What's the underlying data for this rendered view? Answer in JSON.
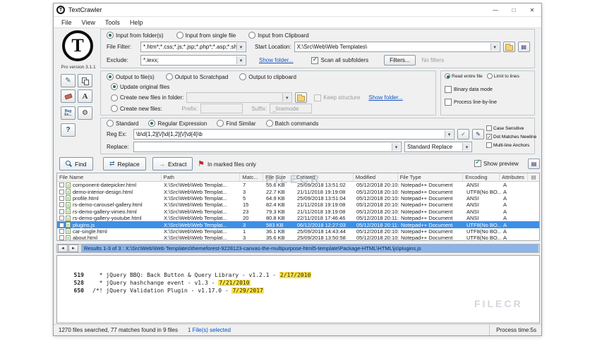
{
  "watermark": "FILECR",
  "window": {
    "title": "TextCrawler",
    "minimize": "—",
    "maximize": "□",
    "close": "✕"
  },
  "menu": {
    "items": [
      "File",
      "View",
      "Tools",
      "Help"
    ]
  },
  "icons": {
    "prev": "◄",
    "next": "►",
    "swap": "⇄",
    "extract": "→",
    "flag": "⚑",
    "gear": "⚙",
    "pencil": "✎",
    "grid": "▤",
    "check": "✓"
  },
  "sidebar": {
    "logo_letter": "T",
    "version": "Pro version 3.1.1",
    "regex_button": "Reg Ex...",
    "letter_button": "A",
    "help_button": "?"
  },
  "input_panel": {
    "radio_folder": "Input from folder(s)",
    "radio_single": "Input from single file",
    "radio_clipboard": "Input from Clipboard",
    "file_filter_label": "File Filter:",
    "file_filter_value": "*.htm*;*.css;*.js;*.jsp;*.php*;*.asp;*.shtml",
    "start_location_label": "Start Location:",
    "start_location_value": "X:\\Src\\Web\\Web Templates\\",
    "exclude_label": "Exclude:",
    "exclude_value": "*.iexx;",
    "show_folder_link": "Show folder...",
    "scan_subfolders": "Scan all subfolders",
    "filters_button": "Filters...",
    "no_filters": "No filters"
  },
  "output_panel": {
    "radio_files": "Output to file(s)",
    "radio_scratchpad": "Output to Scratchpad",
    "radio_clipboard": "Output to clipboard",
    "radio_update": "Update original files",
    "radio_new_folder": "Create new files in folder:",
    "keep_structure": "Keep structure",
    "show_folder_link": "Show folder...",
    "radio_new_files": "Create new files:",
    "prefix_label": "Prefix:",
    "prefix_value": "",
    "suffix_label": "Suffix:",
    "suffix_value": "_linemode"
  },
  "read_panel": {
    "radio_entire": "Read entire file",
    "radio_limit": "Limit to lines",
    "binary_mode": "Binary data mode",
    "line_by_line": "Process line-by-line"
  },
  "search_panel": {
    "radio_standard": "Standard",
    "radio_regex": "Regular Expression",
    "radio_similar": "Find Similar",
    "radio_batch": "Batch commands",
    "regex_label": "Reg Ex:",
    "regex_value": "\\b\\d{1,2}[\\/]\\d{1,2}[\\/]\\d{4}\\b",
    "replace_label": "Replace:",
    "replace_value": "",
    "replace_mode": "Standard Replace",
    "case_sensitive": "Case Sensitive",
    "dot_matches": "Dot Matches Newline",
    "multiline": "Multi-line Anchors"
  },
  "actions": {
    "find": "Find",
    "replace": "Replace",
    "extract": "Extract",
    "marked_only": "In marked files only",
    "show_preview": "Show preview"
  },
  "table": {
    "headers": [
      "File Name",
      "Path",
      "Matc...",
      "File Size",
      "Created",
      "Modified",
      "File Type",
      "Encoding",
      "Attributes"
    ],
    "rows": [
      {
        "name": "component-datepicker.html",
        "path": "X:\\Src\\Web\\Web Templat...",
        "matches": "7",
        "size": "55.6 KB",
        "created": "25/09/2018 13:51:02",
        "modified": "05/12/2018 20:10:...",
        "type": "Notepad++ Document",
        "encoding": "ANSI",
        "attrs": "A",
        "selected": false
      },
      {
        "name": "demo-interior-design.html",
        "path": "X:\\Src\\Web\\Web Templat...",
        "matches": "3",
        "size": "22.7 KB",
        "created": "21/11/2018 19:19:08",
        "modified": "05/12/2018 20:10:...",
        "type": "Notepad++ Document",
        "encoding": "UTF8(No BO...",
        "attrs": "A",
        "selected": false
      },
      {
        "name": "profile.html",
        "path": "X:\\Src\\Web\\Web Templat...",
        "matches": "5",
        "size": "64.9 KB",
        "created": "25/09/2018 13:51:04",
        "modified": "05/12/2018 20:10:...",
        "type": "Notepad++ Document",
        "encoding": "ANSI",
        "attrs": "A",
        "selected": false
      },
      {
        "name": "rs-demo-carousel-gallery.html",
        "path": "X:\\Src\\Web\\Web Templat...",
        "matches": "15",
        "size": "82.4 KB",
        "created": "21/11/2018 19:19:08",
        "modified": "05/12/2018 20:10:...",
        "type": "Notepad++ Document",
        "encoding": "ANSI",
        "attrs": "A",
        "selected": false
      },
      {
        "name": "rs-demo-gallery-vimeo.html",
        "path": "X:\\Src\\Web\\Web Templat...",
        "matches": "23",
        "size": "79.3 KB",
        "created": "21/11/2018 19:19:08",
        "modified": "05/12/2018 20:10:...",
        "type": "Notepad++ Document",
        "encoding": "ANSI",
        "attrs": "A",
        "selected": false
      },
      {
        "name": "rs-demo-gallery-youtube.html",
        "path": "X:\\Src\\Web\\Web Templat...",
        "matches": "20",
        "size": "80.8 KB",
        "created": "22/11/2018 17:46:46",
        "modified": "05/12/2018 20:11:...",
        "type": "Notepad++ Document",
        "encoding": "ANSI",
        "attrs": "A",
        "selected": false
      },
      {
        "name": "plugins.js",
        "path": "X:\\Src\\Web\\Web Templat...",
        "matches": "3",
        "size": "583 KB",
        "created": "06/12/2018 12:27:03",
        "modified": "05/12/2018 20:11:...",
        "type": "Notepad++ Document",
        "encoding": "UTF8(No BO...",
        "attrs": "A",
        "selected": true
      },
      {
        "name": "car-single.html",
        "path": "X:\\Src\\Web\\Web Templat...",
        "matches": "1",
        "size": "36.1 KB",
        "created": "25/09/2018 14:43:44",
        "modified": "05/12/2018 20:10:...",
        "type": "Notepad++ Document",
        "encoding": "UTF8(No BO...",
        "attrs": "A",
        "selected": false
      },
      {
        "name": "about.html",
        "path": "X:\\Src\\Web\\Web Templat...",
        "matches": "3",
        "size": "35.6 KB",
        "created": "25/09/2018 13:50:58",
        "modified": "05/12/2018 20:10:...",
        "type": "Notepad++ Document",
        "encoding": "UTF8(No BO...",
        "attrs": "A",
        "selected": false
      }
    ]
  },
  "results_bar": {
    "text": "Results 1-3 of 3 :  X:\\Src\\Web\\Web Templates\\themeforest-9228123-canvas-the-multipurpose-html5-template\\Package-HTML\\HTML\\js\\plugins.js"
  },
  "preview": {
    "lines": [
      {
        "num": "519",
        "text": "  * jQuery BBQ: Back Button & Query Library - v1.2.1 - ",
        "date": "2/17/2010"
      },
      {
        "num": "528",
        "text": "  * jQuery hashchange event - v1.3 - ",
        "date": "7/21/2010"
      },
      {
        "num": "650",
        "text": "/*! jQuery Validation Plugin - v1.17.0 - ",
        "date": "7/29/2017"
      }
    ]
  },
  "status_bar": {
    "left": "1270 files searched, 77 matches found in 9 files",
    "selected": "1 File(s) selected",
    "right": "Process time:5s"
  }
}
